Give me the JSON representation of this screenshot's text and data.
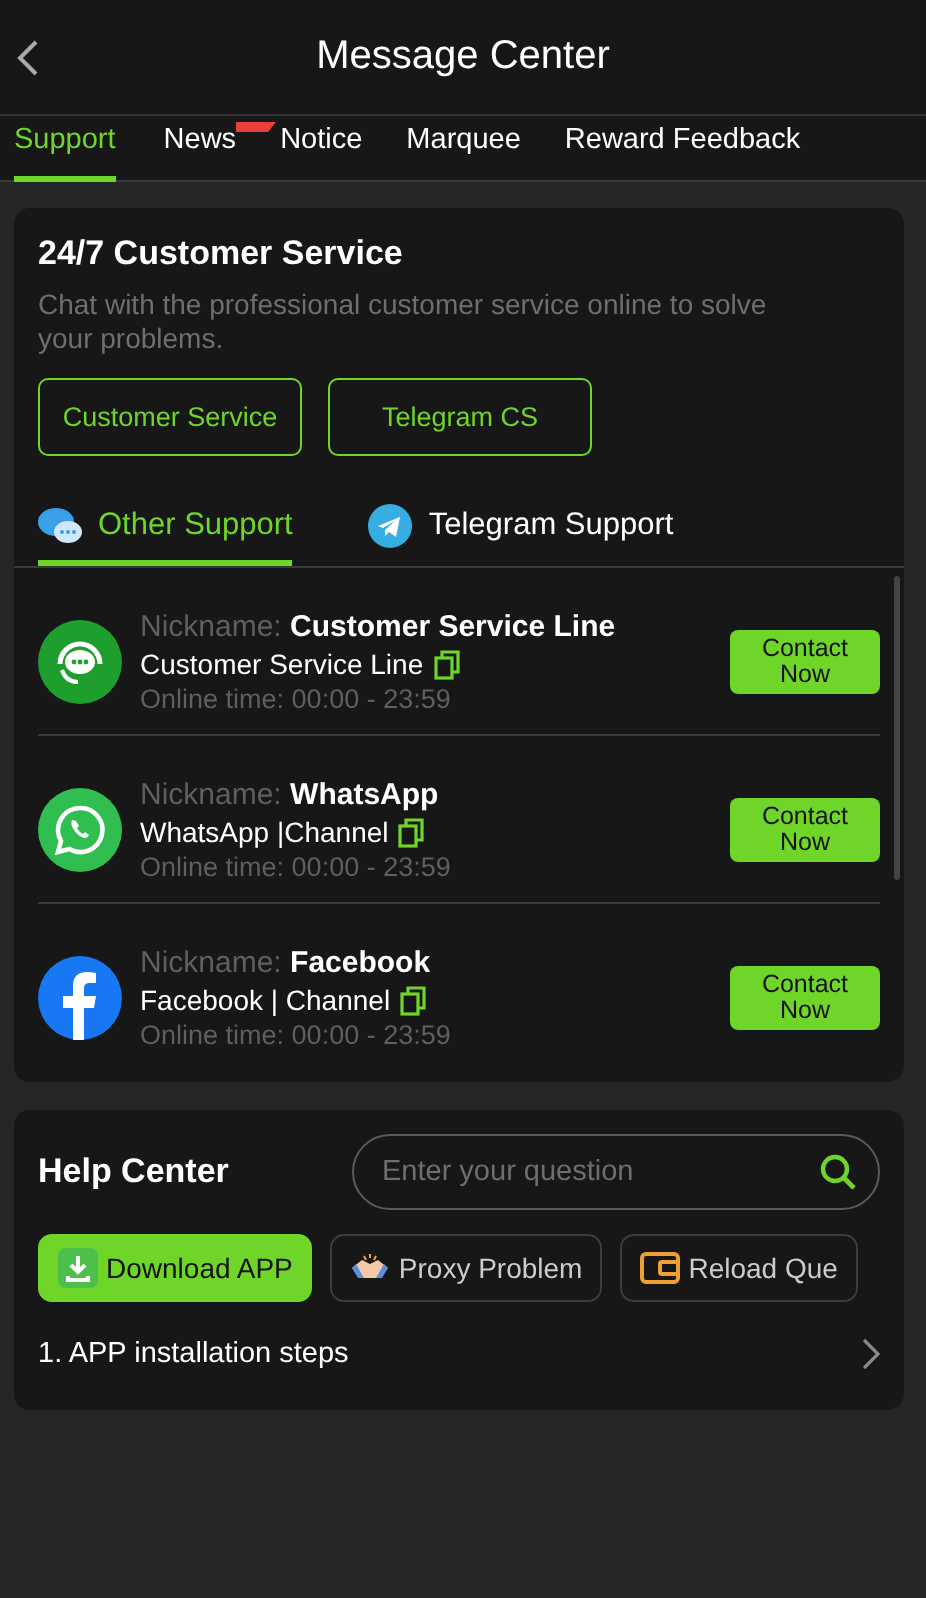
{
  "header": {
    "title": "Message Center"
  },
  "tabs": [
    {
      "label": "Support",
      "selected": true,
      "badge": false
    },
    {
      "label": "News",
      "selected": false,
      "badge": true
    },
    {
      "label": "Notice",
      "selected": false,
      "badge": false
    },
    {
      "label": "Marquee",
      "selected": false,
      "badge": false
    },
    {
      "label": "Reward Feedback",
      "selected": false,
      "badge": false
    }
  ],
  "customer_service": {
    "title": "24/7 Customer Service",
    "description": "Chat with the professional customer service online to solve your problems.",
    "buttons": [
      "Customer Service",
      "Telegram CS"
    ]
  },
  "support_tabs": [
    {
      "label": "Other Support",
      "kind": "chat",
      "selected": true
    },
    {
      "label": "Telegram Support",
      "kind": "telegram",
      "selected": false
    }
  ],
  "contacts": [
    {
      "kind": "headset",
      "nickname_label": "Nickname:",
      "nickname": "Customer Service Line",
      "channel": "Customer Service Line",
      "online_label": "Online time:",
      "online_time": "00:00 - 23:59",
      "action": "Contact Now"
    },
    {
      "kind": "whatsapp",
      "nickname_label": "Nickname:",
      "nickname": "WhatsApp",
      "channel": "WhatsApp |Channel",
      "online_label": "Online time:",
      "online_time": "00:00 - 23:59",
      "action": "Contact Now"
    },
    {
      "kind": "facebook",
      "nickname_label": "Nickname:",
      "nickname": "Facebook",
      "channel": "Facebook | Channel",
      "online_label": "Online time:",
      "online_time": "00:00 - 23:59",
      "action": "Contact Now"
    }
  ],
  "help_center": {
    "title": "Help Center",
    "search": {
      "placeholder": "Enter your question"
    },
    "categories": [
      {
        "label": "Download APP",
        "kind": "download",
        "selected": true
      },
      {
        "label": "Proxy Problem",
        "kind": "handshake",
        "selected": false
      },
      {
        "label": "Reload Que",
        "kind": "wallet",
        "selected": false
      }
    ],
    "questions": [
      "1. APP installation steps"
    ]
  }
}
